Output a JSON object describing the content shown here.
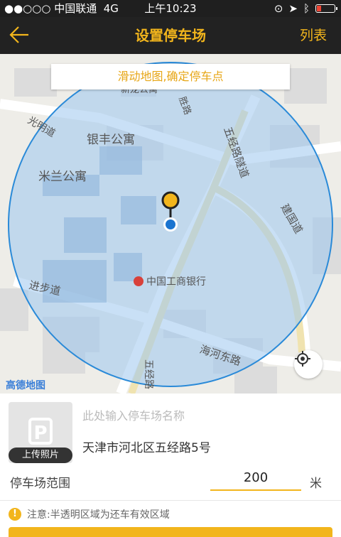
{
  "status_bar": {
    "carrier": "●●○○○ 中国联通",
    "network": "4G",
    "time": "上午10:23"
  },
  "nav": {
    "title": "设置停车场",
    "right_label": "列表"
  },
  "map": {
    "hint": "滑动地图,确定停车点",
    "labels": {
      "yinfeng": "银丰公寓",
      "milan": "米兰公寓",
      "guangming": "光明道",
      "jinbu": "进步道",
      "wujinglu_suidao": "五经路隧道",
      "jianguo": "建国道",
      "haihe": "海河东路",
      "wujinglu": "五经路",
      "icbc": "中国工商银行",
      "top_partial": "新龙公寓",
      "top_partial2": "胜路"
    },
    "logo": "高德地图",
    "colors": {
      "circle_fill": "#9cc7ee",
      "circle_stroke": "#2a8ad8",
      "pin": "#f2b51c"
    }
  },
  "form": {
    "photo_label": "上传照片",
    "name_placeholder": "此处输入停车场名称",
    "address": "天津市河北区五经路5号",
    "range_label": "停车场范围",
    "range_value": "200",
    "range_unit": "米",
    "note": "注意:半透明区域为还车有效区域"
  }
}
